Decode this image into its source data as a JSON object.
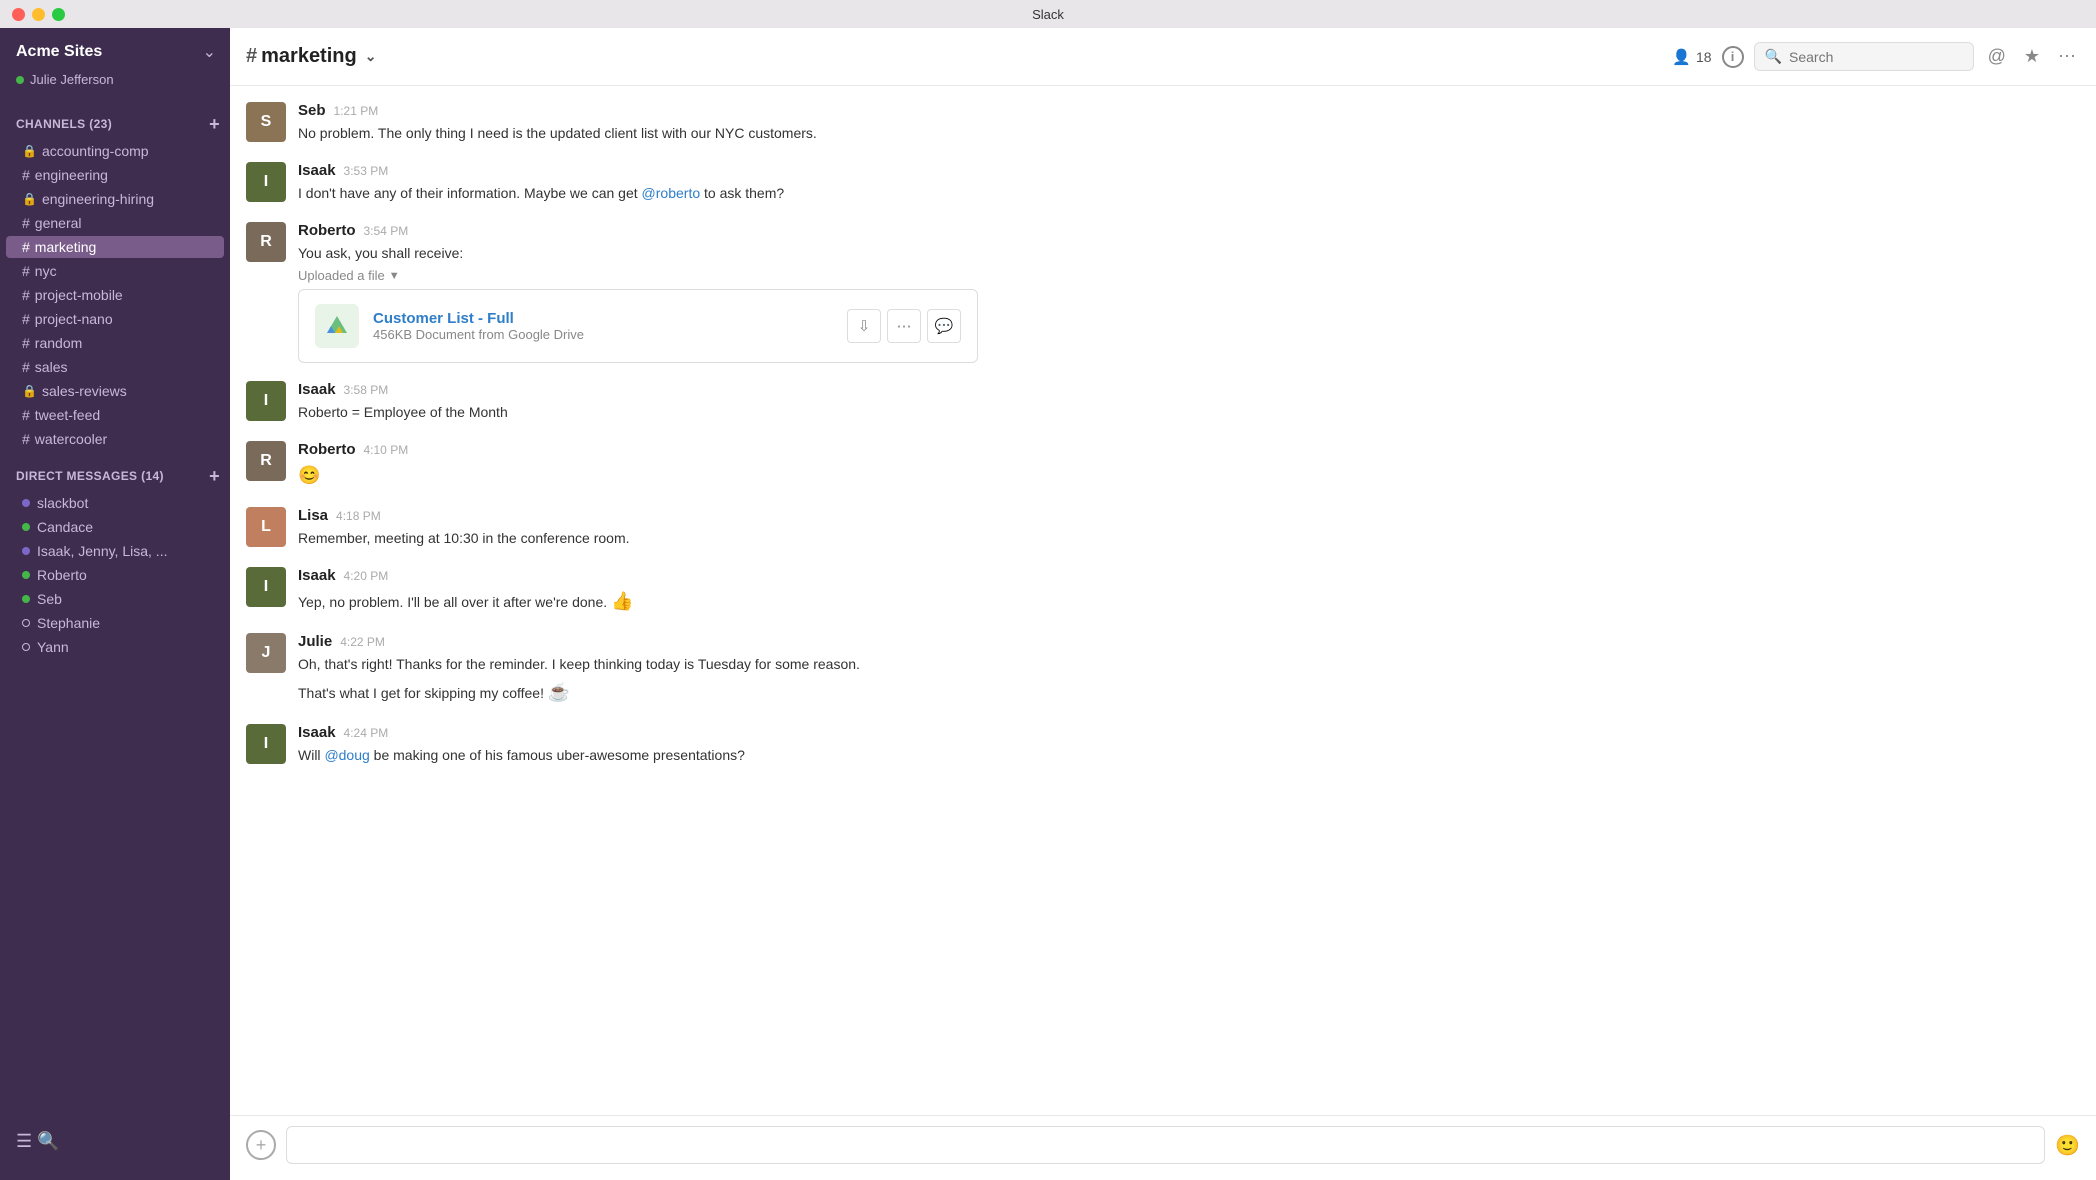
{
  "titlebar": {
    "title": "Slack"
  },
  "sidebar": {
    "workspace": "Acme Sites",
    "user": "Julie Jefferson",
    "channels_header": "CHANNELS",
    "channels_count": "23",
    "channels": [
      {
        "name": "accounting-comp",
        "type": "lock"
      },
      {
        "name": "engineering",
        "type": "hash"
      },
      {
        "name": "engineering-hiring",
        "type": "lock"
      },
      {
        "name": "general",
        "type": "hash"
      },
      {
        "name": "marketing",
        "type": "hash",
        "active": true
      },
      {
        "name": "nyc",
        "type": "hash"
      },
      {
        "name": "project-mobile",
        "type": "hash"
      },
      {
        "name": "project-nano",
        "type": "hash"
      },
      {
        "name": "random",
        "type": "hash"
      },
      {
        "name": "sales",
        "type": "hash"
      },
      {
        "name": "sales-reviews",
        "type": "lock"
      },
      {
        "name": "tweet-feed",
        "type": "hash"
      },
      {
        "name": "watercooler",
        "type": "hash"
      }
    ],
    "dm_header": "DIRECT MESSAGES",
    "dm_count": "14",
    "dms": [
      {
        "name": "slackbot",
        "dot": "purple"
      },
      {
        "name": "Candace",
        "dot": "green"
      },
      {
        "name": "Isaak, Jenny, Lisa, ...",
        "dot": "purple"
      },
      {
        "name": "Roberto",
        "dot": "green"
      },
      {
        "name": "Seb",
        "dot": "green"
      },
      {
        "name": "Stephanie",
        "dot": "hollow"
      },
      {
        "name": "Yann",
        "dot": "hollow"
      }
    ]
  },
  "channel": {
    "name": "marketing",
    "member_count": "18",
    "search_placeholder": "Search"
  },
  "messages": [
    {
      "id": "seb-1",
      "author": "Seb",
      "time": "1:21 PM",
      "avatar_label": "S",
      "avatar_class": "avatar-seb",
      "text": "No problem. The only thing I need is the updated client list with our NYC customers."
    },
    {
      "id": "isaak-1",
      "author": "Isaak",
      "time": "3:53 PM",
      "avatar_label": "I",
      "avatar_class": "avatar-isaak",
      "text": "I don't have any of their information. Maybe we can get",
      "mention": "@roberto",
      "text_after": "to ask them?"
    },
    {
      "id": "roberto-1",
      "author": "Roberto",
      "time": "3:54 PM",
      "avatar_label": "R",
      "avatar_class": "avatar-roberto",
      "text": "You ask, you shall receive:",
      "has_file": true,
      "file": {
        "name": "Customer List - Full",
        "meta": "456KB Document from Google Drive"
      }
    },
    {
      "id": "isaak-2",
      "author": "Isaak",
      "time": "3:58 PM",
      "avatar_label": "I",
      "avatar_class": "avatar-isaak",
      "text": "Roberto = Employee of the Month"
    },
    {
      "id": "roberto-2",
      "author": "Roberto",
      "time": "4:10 PM",
      "avatar_label": "R",
      "avatar_class": "avatar-roberto",
      "text": "😊"
    },
    {
      "id": "lisa-1",
      "author": "Lisa",
      "time": "4:18 PM",
      "avatar_label": "L",
      "avatar_class": "avatar-lisa",
      "text": "Remember, meeting at 10:30 in the conference room."
    },
    {
      "id": "isaak-3",
      "author": "Isaak",
      "time": "4:20 PM",
      "avatar_label": "I",
      "avatar_class": "avatar-isaak",
      "text": "Yep, no problem. I'll be all over it after we're done. 👍"
    },
    {
      "id": "julie-1",
      "author": "Julie",
      "time": "4:22 PM",
      "avatar_label": "J",
      "avatar_class": "avatar-julie",
      "text": "Oh, that's right! Thanks for the reminder. I keep thinking today is Tuesday for some reason.",
      "text2": "That's what I get for skipping my coffee! ☕"
    },
    {
      "id": "isaak-4",
      "author": "Isaak",
      "time": "4:24 PM",
      "avatar_label": "I",
      "avatar_class": "avatar-isaak",
      "text": "Will",
      "mention": "@doug",
      "text_after": "be making one of his famous uber-awesome presentations?"
    }
  ],
  "input": {
    "placeholder": ""
  },
  "labels": {
    "uploaded_a_file": "Uploaded a file"
  }
}
